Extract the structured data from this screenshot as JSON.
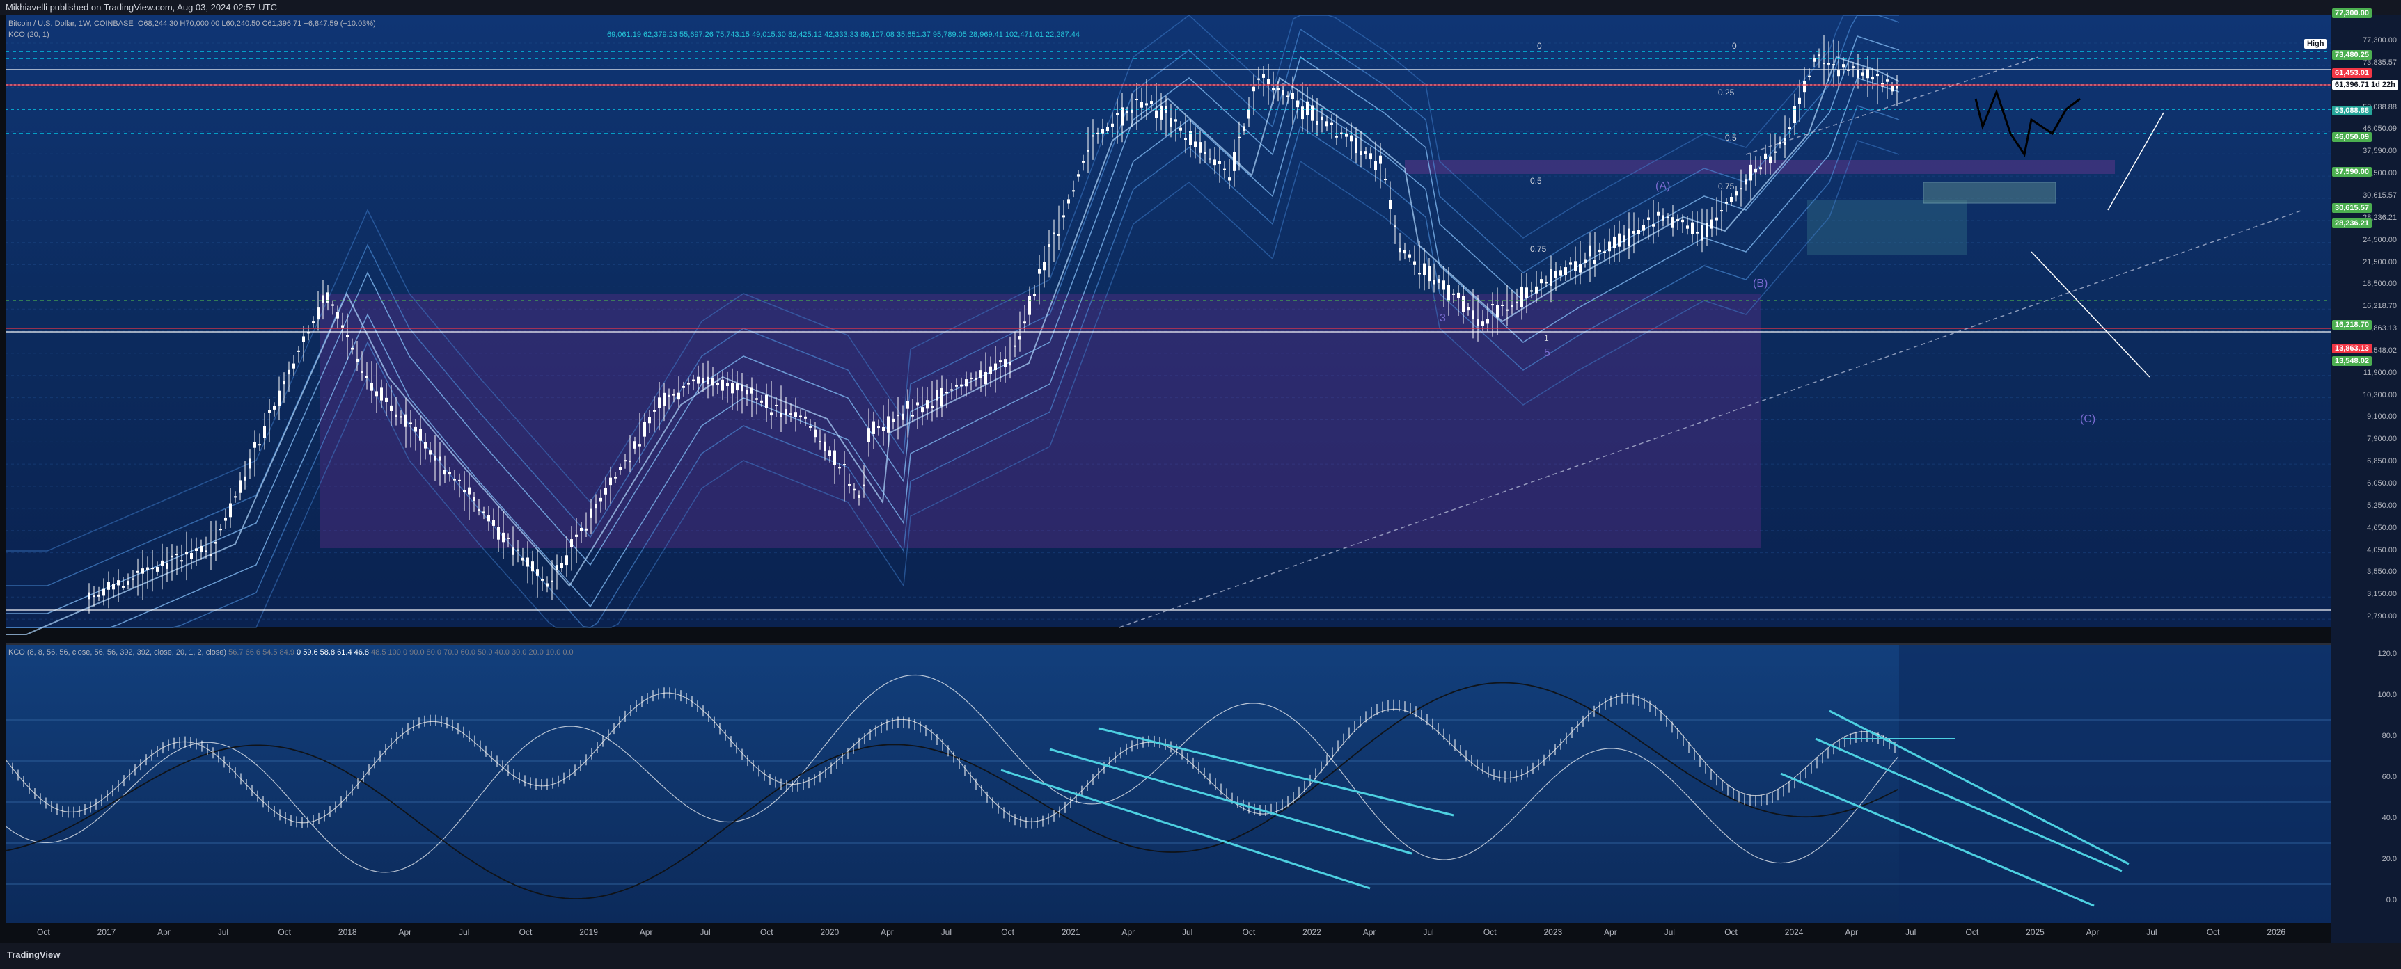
{
  "header": {
    "publisher": "Mikhiavelli published on TradingView.com, Aug 03, 2024 02:57 UTC"
  },
  "legend": {
    "symbol": "Bitcoin / U.S. Dollar, 1W, COINBASE",
    "ohlc": "O68,244.30 H70,000.00 L60,240.50 C61,396.71 −6,847.59 (−10.03%)",
    "indicator1": "KCO (20, 1)",
    "indicator1_values": "69,061.19  62,379.23  55,697.26  75,743.15  49,015.30  82,425.12  42,333.33  89,107.08  35,651.37  95,789.05  28,969.41  102,471.01  22,287.44",
    "osc_name": "KCO (8, 8, 56, 56, close, 56, 56, 392, 392, close, 20, 1, 2, close)",
    "osc_values": [
      "56.7",
      "66.6",
      "54.5",
      "84.9",
      "0",
      "59.6",
      "58.8",
      "61.4",
      "46.8",
      "48.5",
      "100.0",
      "90.0",
      "80.0",
      "70.0",
      "60.0",
      "50.0",
      "40.0",
      "30.0",
      "20.0",
      "10.0",
      "0.0"
    ]
  },
  "price_axis": {
    "labels": [
      "77,300.00",
      "73,835.57",
      "61,396.71",
      "53,088.88",
      "46,050.09",
      "37,590.00",
      "32,500.00",
      "30,615.57",
      "28,236.21",
      "24,500.00",
      "21,500.00",
      "18,500.00",
      "16,218.70",
      "13,863.13",
      "13,548.02",
      "11,900.00",
      "10,300.00",
      "9,100.00",
      "7,900.00",
      "6,850.00",
      "6,050.00",
      "5,250.00",
      "4,650.00",
      "4,050.00",
      "3,550.00",
      "3,150.00",
      "2,790.00"
    ],
    "badges": [
      {
        "text": "77,300.00",
        "color": "#4caf50"
      },
      {
        "text": "73,480.25",
        "color": "#4caf50"
      },
      {
        "text": "61,453.01",
        "color": "#f23645"
      },
      {
        "text": "53,088.88",
        "color": "#26a69a"
      },
      {
        "text": "46,050.09",
        "color": "#4caf50"
      },
      {
        "text": "37,590.00",
        "color": "#4caf50"
      },
      {
        "text": "30,615.57",
        "color": "#4caf50"
      },
      {
        "text": "28,236.21",
        "color": "#4caf50"
      },
      {
        "text": "16,218.70",
        "color": "#4caf50"
      },
      {
        "text": "13,863.13",
        "color": "#f23645"
      },
      {
        "text": "13,548.02",
        "color": "#4caf50"
      }
    ],
    "high_label": "High",
    "current": "61,396.71",
    "countdown": "1d 22h"
  },
  "osc_axis": [
    "120.0",
    "100.0",
    "80.0",
    "60.0",
    "40.0",
    "20.0",
    "0.0"
  ],
  "time_axis": [
    "Oct",
    "2017",
    "Apr",
    "Jul",
    "Oct",
    "2018",
    "Apr",
    "Jul",
    "Oct",
    "2019",
    "Apr",
    "Jul",
    "Oct",
    "2020",
    "Apr",
    "Jul",
    "Oct",
    "2021",
    "Apr",
    "Jul",
    "Oct",
    "2022",
    "Apr",
    "Jul",
    "Oct",
    "2023",
    "Apr",
    "Jul",
    "Oct",
    "2024",
    "Apr",
    "Jul",
    "Oct",
    "2025",
    "Apr",
    "Jul",
    "Oct",
    "2026"
  ],
  "annotations": {
    "fib": [
      "0",
      "0",
      "0.25",
      "0.5",
      "0.5",
      "0.75",
      "0.75",
      "1"
    ],
    "waves": [
      "(A)",
      "(B)",
      "(C)",
      "3",
      "5"
    ]
  },
  "footer": {
    "brand": "TradingView"
  },
  "colors": {
    "bg": "#0d2a5c",
    "band": "#1c5aa8",
    "candle": "#ffffff",
    "osc_line": "#26c6da",
    "rect": "#5a2a8a"
  }
}
